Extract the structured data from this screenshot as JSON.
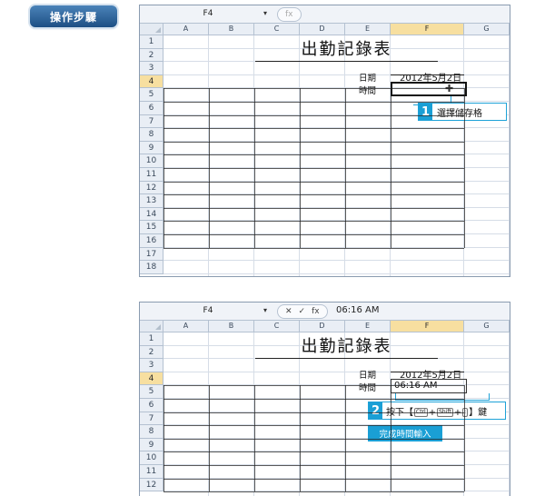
{
  "badge": {
    "label": "操作步驟"
  },
  "sheet1": {
    "name_box": "F4",
    "formula_text": "",
    "columns": [
      "A",
      "B",
      "C",
      "D",
      "E",
      "F",
      "G"
    ],
    "rows": [
      "1",
      "2",
      "3",
      "4",
      "5",
      "6",
      "7",
      "8",
      "9",
      "10",
      "11",
      "12",
      "13",
      "14",
      "15",
      "16",
      "17",
      "18"
    ],
    "title": "出勤記錄表",
    "date_label": "日期",
    "date_value": "2012年5月2日",
    "time_label": "時間",
    "callout_number": "1",
    "callout_text": "選擇儲存格"
  },
  "sheet2": {
    "name_box": "F4",
    "formula_text": "06:16 AM",
    "columns": [
      "A",
      "B",
      "C",
      "D",
      "E",
      "F",
      "G"
    ],
    "rows": [
      "1",
      "2",
      "3",
      "4",
      "5",
      "6",
      "7",
      "8",
      "9",
      "10",
      "11",
      "12"
    ],
    "title": "出勤記錄表",
    "date_label": "日期",
    "date_value": "2012年5月2日",
    "time_label": "時間",
    "time_value": "06:16 AM",
    "callout_number": "2",
    "callout_prefix": "按下【",
    "key1": "Ctrl",
    "plus": "+",
    "key2": "Shift",
    "key3": ":",
    "callout_suffix": "】鍵",
    "done_text": "完成時間輸入"
  },
  "formula_bar": {
    "dropdown_icon": "▾",
    "fx": "fx",
    "cancel": "✕",
    "confirm": "✓"
  },
  "colors": {
    "accent": "#1a9fd5",
    "header_selected": "#f7dfa0"
  }
}
